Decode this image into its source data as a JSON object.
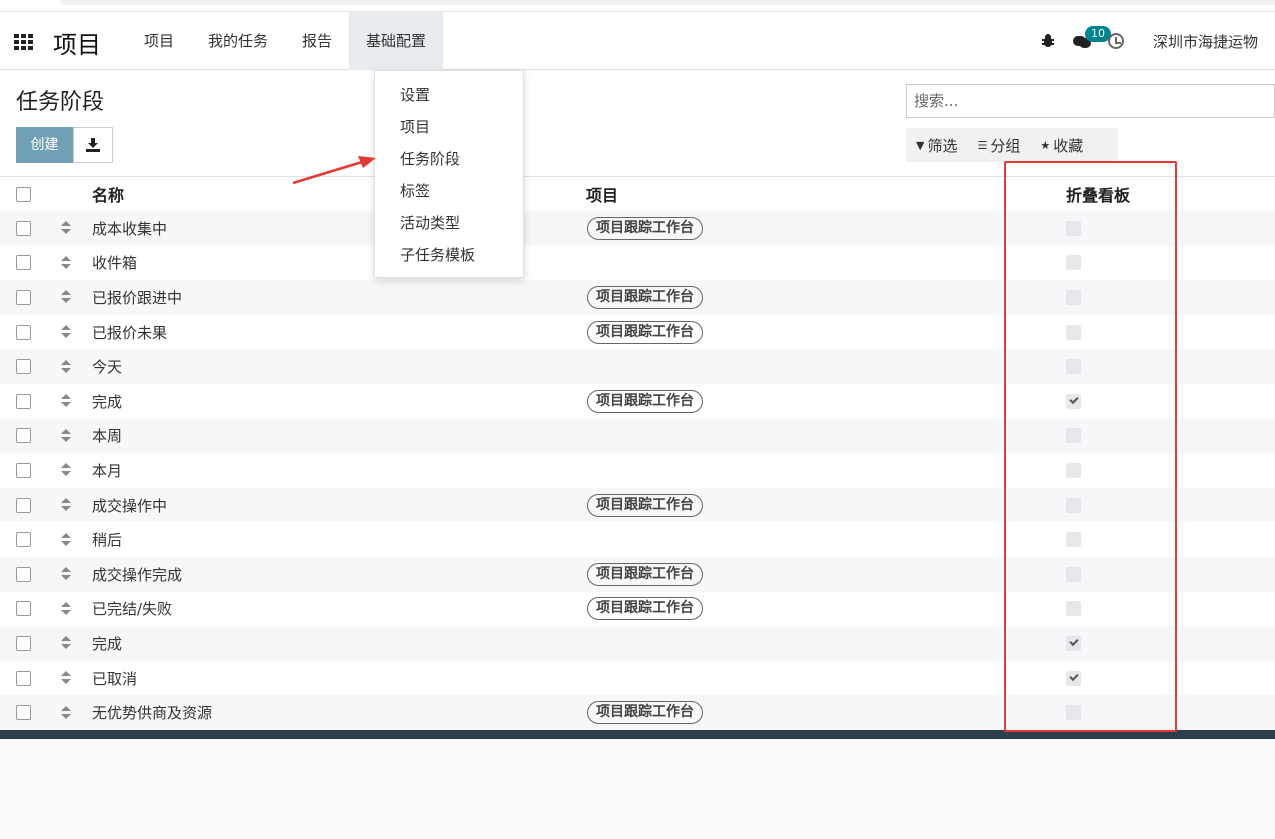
{
  "navbar": {
    "brand": "项目",
    "menu": [
      {
        "label": "项目"
      },
      {
        "label": "我的任务"
      },
      {
        "label": "报告"
      },
      {
        "label": "基础配置",
        "active": true
      }
    ],
    "messages_badge": "10",
    "company": "深圳市海捷运物"
  },
  "dropdown": {
    "items": [
      "设置",
      "项目",
      "任务阶段",
      "标签",
      "活动类型",
      "子任务模板"
    ]
  },
  "control_panel": {
    "title": "任务阶段",
    "create_label": "创建",
    "search_placeholder": "搜索...",
    "filter_label": "筛选",
    "group_label": "分组",
    "favorite_label": "收藏"
  },
  "list": {
    "columns": {
      "name": "名称",
      "project": "项目",
      "fold": "折叠看板"
    },
    "rows": [
      {
        "name": "成本收集中",
        "project": "项目跟踪工作台",
        "folded": false
      },
      {
        "name": "收件箱",
        "project": "",
        "folded": false
      },
      {
        "name": "已报价跟进中",
        "project": "项目跟踪工作台",
        "folded": false
      },
      {
        "name": "已报价未果",
        "project": "项目跟踪工作台",
        "folded": false
      },
      {
        "name": "今天",
        "project": "",
        "folded": false
      },
      {
        "name": "完成",
        "project": "项目跟踪工作台",
        "folded": true
      },
      {
        "name": "本周",
        "project": "",
        "folded": false
      },
      {
        "name": "本月",
        "project": "",
        "folded": false
      },
      {
        "name": "成交操作中",
        "project": "项目跟踪工作台",
        "folded": false
      },
      {
        "name": "稍后",
        "project": "",
        "folded": false
      },
      {
        "name": "成交操作完成",
        "project": "项目跟踪工作台",
        "folded": false
      },
      {
        "name": "已完结/失败",
        "project": "项目跟踪工作台",
        "folded": false
      },
      {
        "name": "完成",
        "project": "",
        "folded": true
      },
      {
        "name": "已取消",
        "project": "",
        "folded": true
      },
      {
        "name": "无优势供商及资源",
        "project": "项目跟踪工作台",
        "folded": false
      }
    ]
  },
  "colors": {
    "create_button": "#71a0b4",
    "badge": "#00848f",
    "highlight_box": "#e53935",
    "footer_bar": "#2c3e4c"
  }
}
